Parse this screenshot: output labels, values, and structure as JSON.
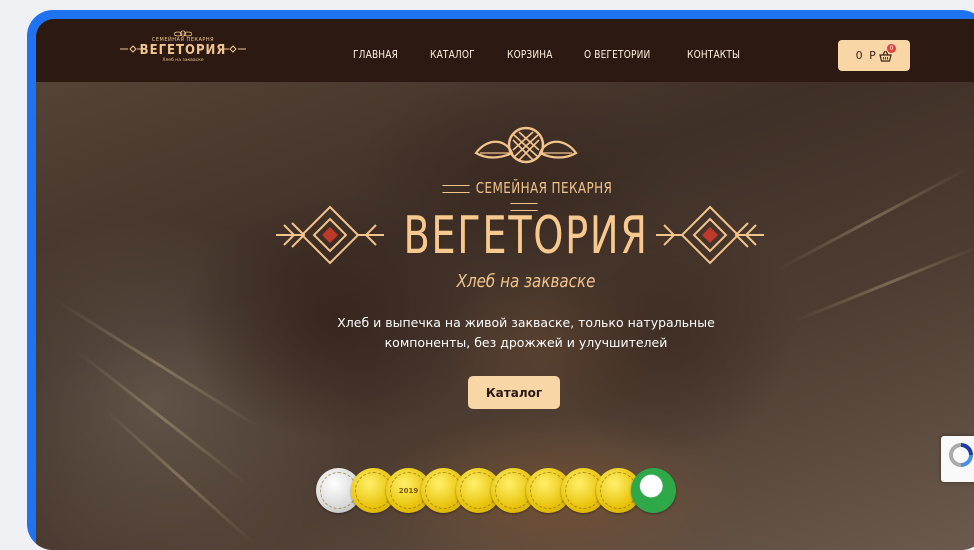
{
  "header": {
    "logo": {
      "top_text": "СЕМЕЙНАЯ ПЕКАРНЯ",
      "name": "ВЕГЕТОРИЯ",
      "bottom_text": "Хлеб на закваске"
    },
    "nav": [
      {
        "label": "ГЛАВНАЯ"
      },
      {
        "label": "КАТАЛОГ"
      },
      {
        "label": "КОРЗИНА"
      },
      {
        "label": "О ВЕГЕТОРИИ"
      },
      {
        "label": "КОНТАКТЫ"
      }
    ],
    "cart": {
      "label": "0 Р",
      "count": "0"
    }
  },
  "hero": {
    "subtitle": "СЕМЕЙНАЯ ПЕКАРНЯ",
    "title": "ВЕГЕТОРИЯ",
    "tagline": "Хлеб на закваске",
    "description_line1": "Хлеб и выпечка на живой закваске, только натуральные",
    "description_line2": "компоненты, без дрожжей и улучшителей",
    "button_label": "Каталог"
  },
  "medals": [
    {
      "type": "silver",
      "label": ""
    },
    {
      "type": "gold",
      "label": ""
    },
    {
      "type": "gold",
      "label": "2019"
    },
    {
      "type": "gold",
      "label": ""
    },
    {
      "type": "gold",
      "label": ""
    },
    {
      "type": "gold",
      "label": ""
    },
    {
      "type": "gold",
      "label": ""
    },
    {
      "type": "gold",
      "label": ""
    },
    {
      "type": "gold",
      "label": ""
    },
    {
      "type": "green",
      "label": ""
    }
  ],
  "colors": {
    "frame_blue": "#1f73f0",
    "header_bg": "#2b1912",
    "accent_cream": "#f9d6a5",
    "title_gold": "#f7c98e",
    "badge_red": "#e8413a"
  }
}
